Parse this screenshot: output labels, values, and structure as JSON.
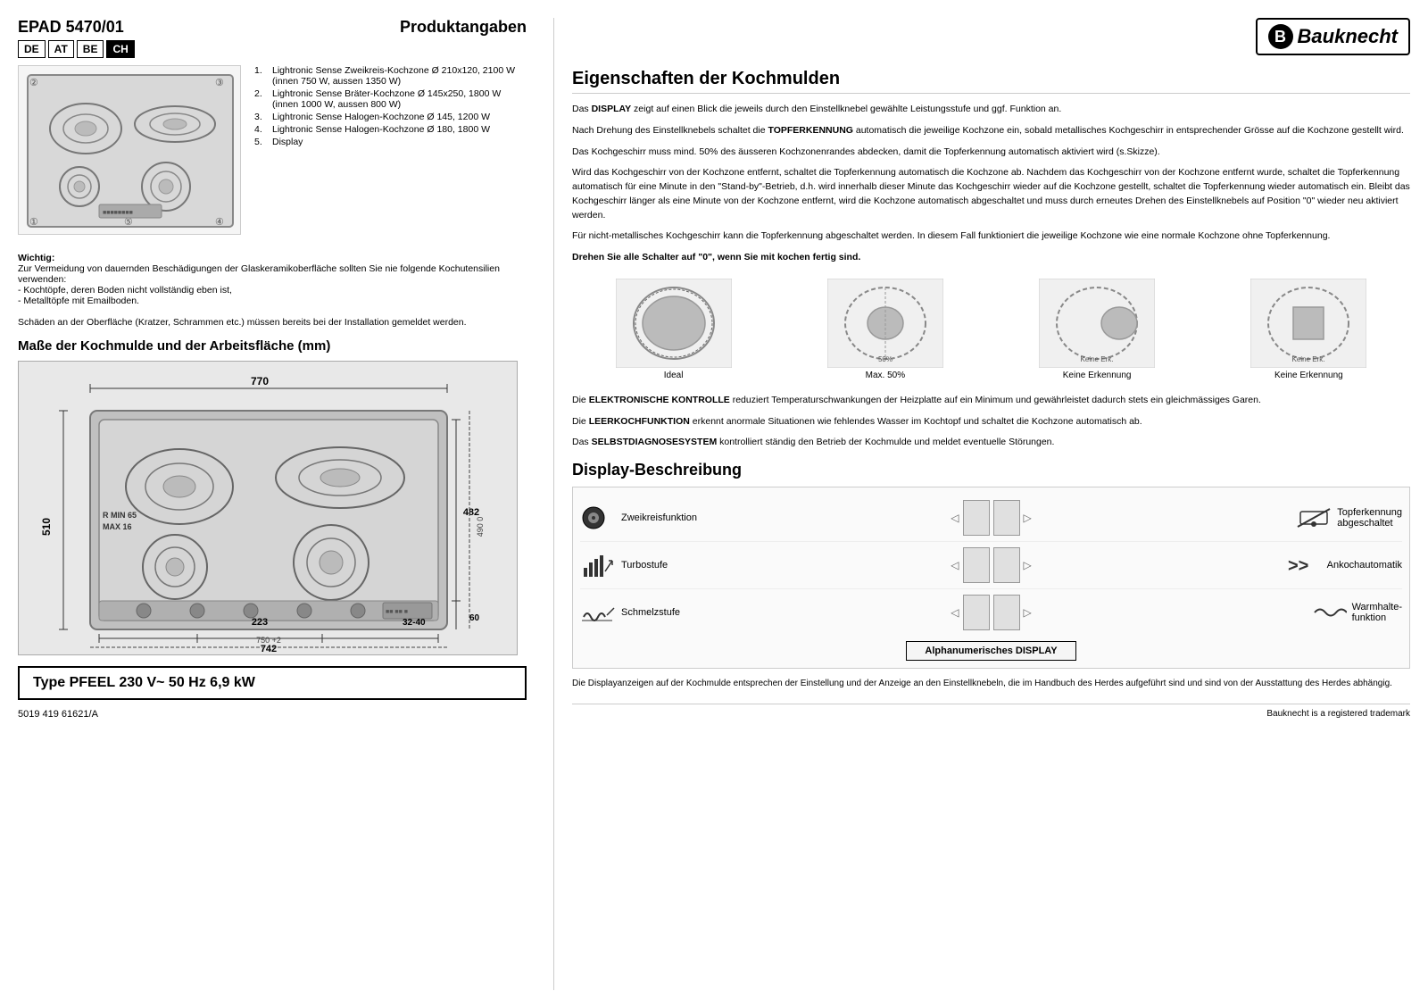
{
  "left": {
    "model": "EPAD 5470/01",
    "produktangaben": "Produktangaben",
    "languages": [
      "DE",
      "AT",
      "BE",
      "CH"
    ],
    "active_lang": "CH",
    "features": [
      {
        "num": "1.",
        "text": "Lightronic Sense Zweikreis-Kochzone Ø 210x120, 2100 W\n(innen 750 W, aussen 1350 W)"
      },
      {
        "num": "2.",
        "text": "Lightronic Sense Bräter-Kochzone Ø 145x250, 1800 W\n(innen 1000 W, aussen 800 W)"
      },
      {
        "num": "3.",
        "text": "Lightronic Sense Halogen-Kochzone Ø 145, 1200 W"
      },
      {
        "num": "4.",
        "text": "Lightronic Sense Halogen-Kochzone Ø 180, 1800 W"
      },
      {
        "num": "5.",
        "text": "Display"
      }
    ],
    "warning_title": "Wichtig:",
    "warning_text": "Zur Vermeidung von dauernden Beschädigungen der Glaskeramikoberfläche sollten Sie nie folgende Kochutensilien verwenden:\n- Kochtöpfe, deren Boden nicht vollständig eben ist,\n- Metalltöpfe mit Emailboden.",
    "damage_text": "Schäden an der Oberfläche (Kratzer, Schrammen etc.) müssen bereits bei der Installation gemeldet werden.",
    "dimensions_title": "Maße der Kochmulde und der Arbeitsfläche (mm)",
    "dimensions": {
      "d510": "510",
      "d770": "770",
      "d742": "742",
      "d750_2": "750 +2",
      "d482": "482",
      "d490_0": "490 0",
      "d60": "60",
      "d223": "223",
      "d32_40": "32-40",
      "rmin": "R MIN 65",
      "maxval": "MAX 16"
    },
    "type_label": "Type PFEEL 230 V~ 50 Hz  6,9 kW",
    "doc_number": "5019 419 61621/A"
  },
  "right": {
    "logo": "Bauknecht",
    "eigenschaften_title": "Eigenschaften der Kochmulden",
    "paragraphs": [
      "Das <b>DISPLAY</b> zeigt auf einen Blick die jeweils durch den Einstellknebel gewählte Leistungsstufe und ggf. Funktion an.",
      "Nach Drehung des Einstellknebels schaltet die <b>TOPFERKENNUNG</b> automatisch die jeweilige Kochzone ein, sobald metallisches Kochgeschirr in entsprechender Grösse auf die Kochzone gestellt wird.",
      "Das Kochgeschirr muss mind. 50% des äusseren Kochzonenrandes abdecken, damit die Topferkennung automatisch aktiviert wird (s.Skizze).",
      "Wird das Kochgeschirr von der Kochzone entfernt, schaltet die Topferkennung automatisch die Kochzone ab. Nachdem das Kochgeschirr von der Kochzone entfernt wurde, schaltet die Topferkennung automatisch für eine Minute in den \"Stand-by\"-Betrieb, d.h. wird innerhalb dieser Minute das Kochgeschirr wieder auf die Kochzone gestellt, schaltet die Topferkennung wieder automatisch ein. Bleibt das Kochgeschirr länger als eine Minute von der Kochzone entfernt, wird die Kochzone automatisch abgeschaltet und muss durch erneutes Drehen des Einstellknebels auf Position \"0\" wieder neu aktiviert werden.",
      "Für nicht-metallisches Kochgeschirr kann die Topferkennung abgeschaltet werden. In diesem Fall funktioniert die jeweilige Kochzone wie eine normale Kochzone ohne Topferkennung.",
      "<b>Drehen Sie alle Schalter auf \"0\", wenn Sie mit kochen fertig sind.</b>"
    ],
    "cookware_images": [
      {
        "label": "Ideal"
      },
      {
        "label": "Max. 50%"
      },
      {
        "label": "Keine Erkennung"
      },
      {
        "label": "Keine Erkennung"
      }
    ],
    "elektronische_text": "Die <b>ELEKTRONISCHE KONTROLLE</b> reduziert Temperaturschwankungen der Heizplatte auf ein Minimum und gewährleistet dadurch stets ein gleichmässiges Garen.",
    "leerkoch_text": "Die <b>LEERKOCHFUNKTION</b> erkennt anormale Situationen wie fehlendes Wasser im Kochtopf und schaltet die Kochzone automatisch ab.",
    "selbst_text": "Das <b>SELBSTDIAGNOSESYSTEM</b> kontrolliert ständig den Betrieb der Kochmulde und meldet eventuelle Störungen.",
    "display_title": "Display-Beschreibung",
    "display_rows": [
      {
        "left_icon": "circle-dot",
        "left_label": "Zweikreisfunktion",
        "right_label": "Topferkennung abgeschaltet",
        "right_icon": "pot-off"
      },
      {
        "left_icon": "turbo",
        "left_label": "Turbostufe",
        "right_label": "Ankochautomatik",
        "right_icon": "double-arrow"
      },
      {
        "left_icon": "melt",
        "left_label": "Schmelzstufe",
        "right_label": "Warmhalte-funktion",
        "right_icon": "wave"
      }
    ],
    "alphanumeric_label": "Alphanumerisches DISPLAY",
    "footer_note": "Die Displayanzeigen auf der Kochmulde entsprechen der Einstellung und der Anzeige an den Einstellknebeln, die im Handbuch des Herdes aufgeführt sind und sind von der Ausstattung des Herdes abhängig.",
    "trademark": "Bauknecht is a registered trademark"
  }
}
